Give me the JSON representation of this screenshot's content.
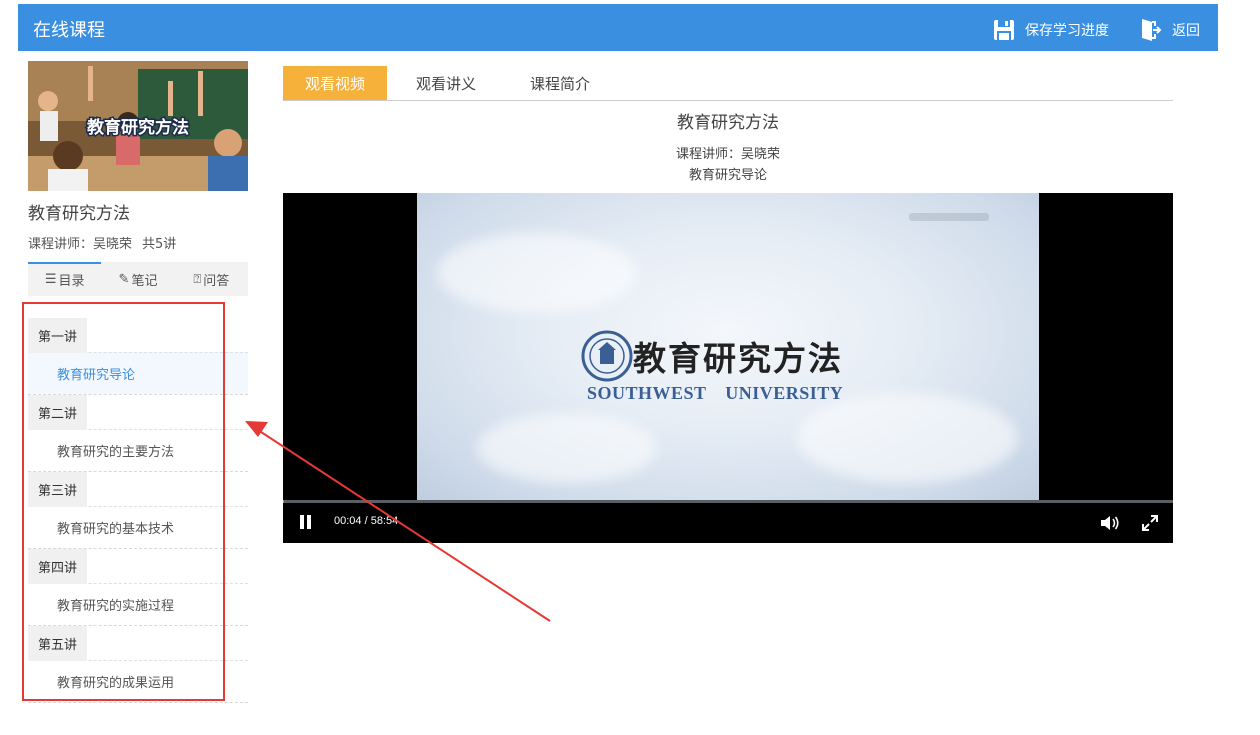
{
  "header": {
    "title": "在线课程",
    "save_label": "保存学习进度",
    "back_label": "返回",
    "bg_color": "#3a8fe0"
  },
  "course": {
    "thumbnail_text": "教育研究方法",
    "name": "教育研究方法",
    "teacher_label": "课程讲师：吴晓荣",
    "count_label": "共5讲"
  },
  "side_tabs": [
    {
      "label": "目录",
      "icon": "list-icon"
    },
    {
      "label": "笔记",
      "icon": "note-icon"
    },
    {
      "label": "问答",
      "icon": "question-icon"
    }
  ],
  "toc": [
    {
      "lecture": "第一讲",
      "lesson": "教育研究导论",
      "active": true
    },
    {
      "lecture": "第二讲",
      "lesson": "教育研究的主要方法"
    },
    {
      "lecture": "第三讲",
      "lesson": "教育研究的基本技术"
    },
    {
      "lecture": "第四讲",
      "lesson": "教育研究的实施过程"
    },
    {
      "lecture": "第五讲",
      "lesson": "教育研究的成果运用"
    }
  ],
  "main_tabs": [
    {
      "label": "观看视频",
      "active": true
    },
    {
      "label": "观看讲义"
    },
    {
      "label": "课程简介"
    }
  ],
  "video": {
    "title": "教育研究方法",
    "teacher": "课程讲师：吴晓荣",
    "lesson": "教育研究导论",
    "frame_title": "教育研究方法",
    "frame_university": "SOUTHWEST UNIVERSITY",
    "time": "00:04 / 58:54",
    "progress": 0.001
  },
  "accent_color": "#f6b13a",
  "annotation_color": "#e53935"
}
